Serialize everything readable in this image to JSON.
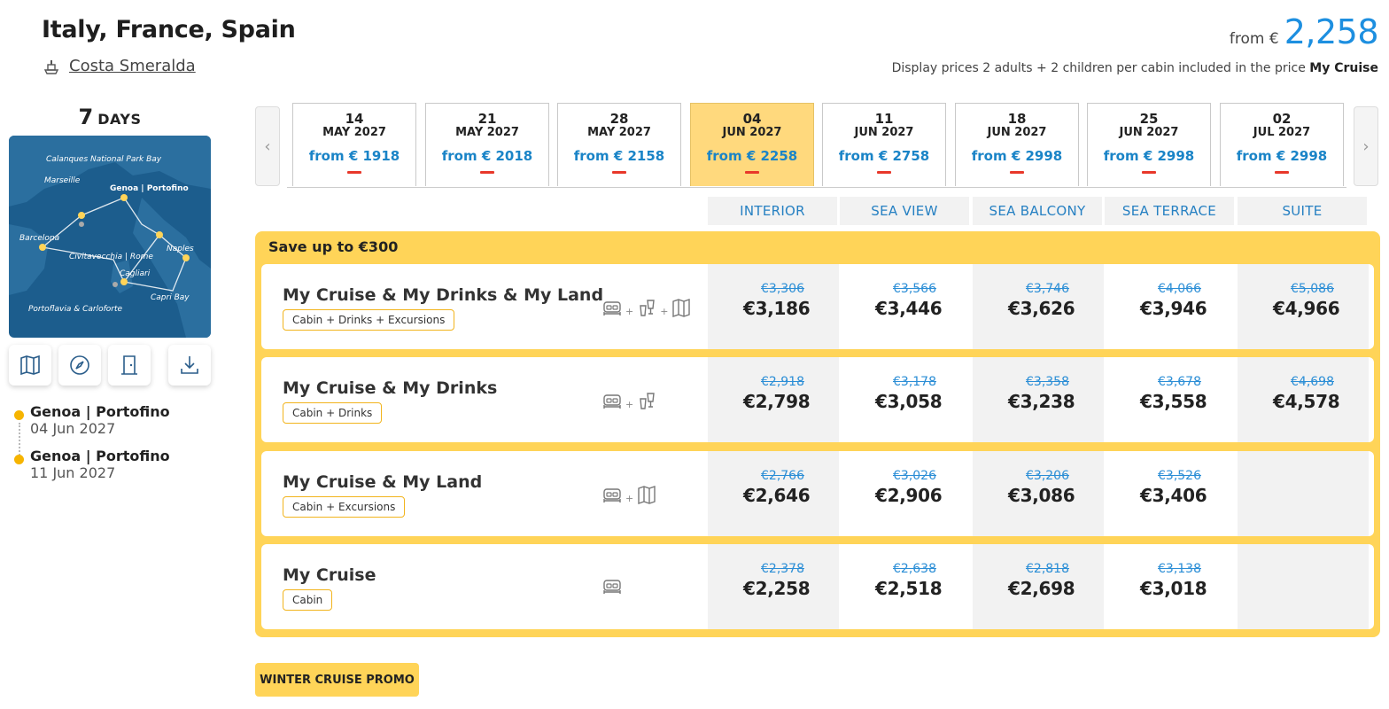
{
  "header": {
    "title": "Italy, France, Spain",
    "ship_name": "Costa Smeralda",
    "from_label": "from €",
    "price": "2,258",
    "display_note": "Display prices 2 adults + 2 children per cabin included in the price",
    "display_note_bold": "My Cruise"
  },
  "duration": {
    "number": "7",
    "label": "DAYS"
  },
  "map": {
    "labels": [
      "Calanques National Park Bay",
      "Marseille",
      "Genoa | Portofino",
      "Barcelona",
      "Civitavecchia | Rome",
      "Naples",
      "Cagliari",
      "Capri Bay",
      "Portoflavia & Carloforte"
    ]
  },
  "itinerary": [
    {
      "name": "Genoa | Portofino",
      "date": "04 Jun 2027"
    },
    {
      "name": "Genoa | Portofino",
      "date": "11 Jun 2027"
    }
  ],
  "dates": [
    {
      "day": "14",
      "month": "MAY 2027",
      "price": "from € 1918"
    },
    {
      "day": "21",
      "month": "MAY 2027",
      "price": "from € 2018"
    },
    {
      "day": "28",
      "month": "MAY 2027",
      "price": "from € 2158"
    },
    {
      "day": "04",
      "month": "JUN 2027",
      "price": "from € 2258",
      "selected": true
    },
    {
      "day": "11",
      "month": "JUN 2027",
      "price": "from € 2758"
    },
    {
      "day": "18",
      "month": "JUN 2027",
      "price": "from € 2998"
    },
    {
      "day": "25",
      "month": "JUN 2027",
      "price": "from € 2998"
    },
    {
      "day": "02",
      "month": "JUL 2027",
      "price": "from € 2998"
    }
  ],
  "carousel": {
    "prev": "‹",
    "next": "›"
  },
  "cabins": [
    "INTERIOR",
    "SEA VIEW",
    "SEA BALCONY",
    "SEA TERRACE",
    "SUITE"
  ],
  "save_label": "Save up to €300",
  "offers": [
    {
      "name": "My Cruise & My Drinks & My Land",
      "tag": "Cabin + Drinks + Excursions",
      "icons": [
        "bed-icon",
        "drink-icon",
        "map-icon"
      ],
      "old": [
        "€3,306",
        "€3,566",
        "€3,746",
        "€4,066",
        "€5,086"
      ],
      "new": [
        "€3,186",
        "€3,446",
        "€3,626",
        "€3,946",
        "€4,966"
      ]
    },
    {
      "name": "My Cruise & My Drinks",
      "tag": "Cabin + Drinks",
      "icons": [
        "bed-icon",
        "drink-icon"
      ],
      "old": [
        "€2,918",
        "€3,178",
        "€3,358",
        "€3,678",
        "€4,698"
      ],
      "new": [
        "€2,798",
        "€3,058",
        "€3,238",
        "€3,558",
        "€4,578"
      ]
    },
    {
      "name": "My Cruise & My Land",
      "tag": "Cabin + Excursions",
      "icons": [
        "bed-icon",
        "map-icon"
      ],
      "old": [
        "€2,766",
        "€3,026",
        "€3,206",
        "€3,526",
        ""
      ],
      "new": [
        "€2,646",
        "€2,906",
        "€3,086",
        "€3,406",
        ""
      ]
    },
    {
      "name": "My Cruise",
      "tag": "Cabin",
      "icons": [
        "bed-icon"
      ],
      "old": [
        "€2,378",
        "€2,638",
        "€2,818",
        "€3,138",
        ""
      ],
      "new": [
        "€2,258",
        "€2,518",
        "€2,698",
        "€3,018",
        ""
      ]
    }
  ],
  "promo_button": "WINTER CRUISE PROMO"
}
